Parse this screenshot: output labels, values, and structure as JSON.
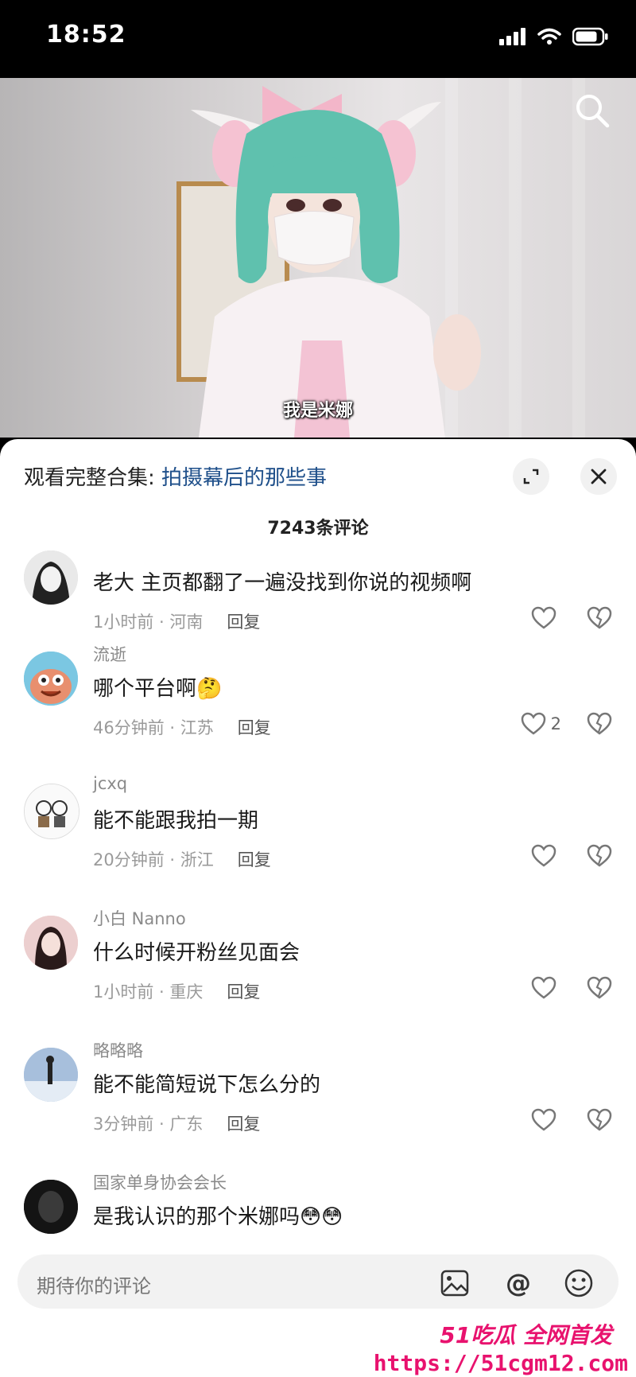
{
  "status": {
    "time": "18:52"
  },
  "video": {
    "subtitle": "我是米娜"
  },
  "sheet": {
    "collection_prefix": "观看完整合集: ",
    "collection_title": "拍摄幕后的那些事",
    "comment_count": "7243条评论"
  },
  "comments": [
    {
      "name": "",
      "text": "老大 主页都翻了一遍没找到你说的视频啊",
      "time": "1小时前 · 河南",
      "reply": "回复",
      "likes": ""
    },
    {
      "name": "流逝",
      "text": "哪个平台啊🤔",
      "time": "46分钟前 · 江苏",
      "reply": "回复",
      "likes": "2"
    },
    {
      "name": "jcxq",
      "text": "能不能跟我拍一期",
      "time": "20分钟前 · 浙江",
      "reply": "回复",
      "likes": ""
    },
    {
      "name": "小白 Nanno",
      "text": "什么时候开粉丝见面会",
      "time": "1小时前 · 重庆",
      "reply": "回复",
      "likes": ""
    },
    {
      "name": "略略略",
      "text": "能不能简短说下怎么分的",
      "time": "3分钟前 · 广东",
      "reply": "回复",
      "likes": ""
    },
    {
      "name": "国家单身协会会长",
      "text": "是我认识的那个米娜吗😳😳",
      "time": "",
      "reply": "",
      "likes": ""
    }
  ],
  "input": {
    "placeholder": "期待你的评论"
  },
  "watermark": {
    "brand": "51吃瓜 全网首发",
    "url": "https://51cgm12.com"
  },
  "colors": {
    "link": "#1e4f8a",
    "watermark": "#e8126e"
  }
}
